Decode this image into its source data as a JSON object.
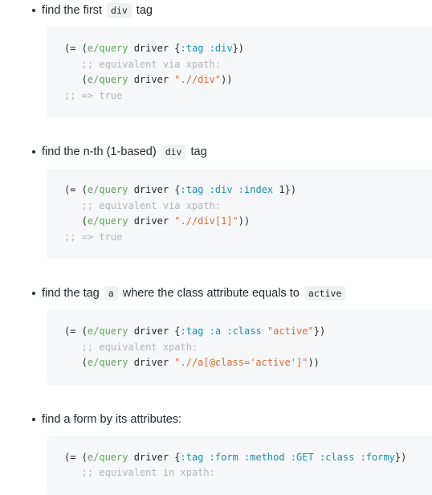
{
  "page": {
    "background": "#ffffff",
    "code_block_background": "#f5f7f8",
    "inline_code_background": "#f0f1f2",
    "colors": {
      "text": "#24292e",
      "function": "#63a35c",
      "keyword": "#1b8fb3",
      "string": "#dd6a33",
      "comment": "#b3b8bd",
      "punctuation": "#24292e"
    }
  },
  "items": [
    {
      "bullet": "•",
      "text_parts": [
        {
          "type": "text",
          "value": "find the first "
        },
        {
          "type": "code",
          "value": "div"
        },
        {
          "type": "text",
          "value": " tag"
        }
      ],
      "plain_text": "find the first div tag",
      "code": {
        "lines": [
          [
            {
              "c": "paren",
              "t": "(= ("
            },
            {
              "c": "fn",
              "t": "e/query"
            },
            {
              "c": "plain",
              "t": " driver "
            },
            {
              "c": "paren",
              "t": "{"
            },
            {
              "c": "kw",
              "t": ":tag"
            },
            {
              "c": "plain",
              "t": " "
            },
            {
              "c": "kw",
              "t": ":div"
            },
            {
              "c": "paren",
              "t": "})"
            }
          ],
          [
            {
              "c": "com",
              "t": "   ;; equivalent via xpath:"
            }
          ],
          [
            {
              "c": "paren",
              "t": "   ("
            },
            {
              "c": "fn",
              "t": "e/query"
            },
            {
              "c": "plain",
              "t": " driver "
            },
            {
              "c": "str",
              "t": "\".//div\""
            },
            {
              "c": "paren",
              "t": "))"
            }
          ],
          [
            {
              "c": "com",
              "t": ";; => true"
            }
          ]
        ],
        "plain_text": "(= (e/query driver {:tag :div})\n   ;; equivalent via xpath:\n   (e/query driver \".//div\"))\n;; => true"
      }
    },
    {
      "bullet": "•",
      "text_parts": [
        {
          "type": "text",
          "value": "find the n-th (1-based) "
        },
        {
          "type": "code",
          "value": "div"
        },
        {
          "type": "text",
          "value": " tag"
        }
      ],
      "plain_text": "find the n-th (1-based) div tag",
      "code": {
        "lines": [
          [
            {
              "c": "paren",
              "t": "(= ("
            },
            {
              "c": "fn",
              "t": "e/query"
            },
            {
              "c": "plain",
              "t": " driver "
            },
            {
              "c": "paren",
              "t": "{"
            },
            {
              "c": "kw",
              "t": ":tag"
            },
            {
              "c": "plain",
              "t": " "
            },
            {
              "c": "kw",
              "t": ":div"
            },
            {
              "c": "plain",
              "t": " "
            },
            {
              "c": "kw",
              "t": ":index"
            },
            {
              "c": "num",
              "t": " 1"
            },
            {
              "c": "paren",
              "t": "})"
            }
          ],
          [
            {
              "c": "com",
              "t": "   ;; equivalent via xpath:"
            }
          ],
          [
            {
              "c": "paren",
              "t": "   ("
            },
            {
              "c": "fn",
              "t": "e/query"
            },
            {
              "c": "plain",
              "t": " driver "
            },
            {
              "c": "str",
              "t": "\".//div[1]\""
            },
            {
              "c": "paren",
              "t": "))"
            }
          ],
          [
            {
              "c": "com",
              "t": ";; => true"
            }
          ]
        ],
        "plain_text": "(= (e/query driver {:tag :div :index 1})\n   ;; equivalent via xpath:\n   (e/query driver \".//div[1]\"))\n;; => true"
      }
    },
    {
      "bullet": "•",
      "text_parts": [
        {
          "type": "text",
          "value": "find the tag "
        },
        {
          "type": "code",
          "value": "a"
        },
        {
          "type": "text",
          "value": " where the class attribute equals to "
        },
        {
          "type": "code",
          "value": "active"
        }
      ],
      "plain_text": "find the tag a where the class attribute equals to active",
      "code": {
        "lines": [
          [
            {
              "c": "paren",
              "t": "(= ("
            },
            {
              "c": "fn",
              "t": "e/query"
            },
            {
              "c": "plain",
              "t": " driver "
            },
            {
              "c": "paren",
              "t": "{"
            },
            {
              "c": "kw",
              "t": ":tag"
            },
            {
              "c": "plain",
              "t": " "
            },
            {
              "c": "kw",
              "t": ":a"
            },
            {
              "c": "plain",
              "t": " "
            },
            {
              "c": "kw",
              "t": ":class"
            },
            {
              "c": "plain",
              "t": " "
            },
            {
              "c": "str",
              "t": "\"active\""
            },
            {
              "c": "paren",
              "t": "})"
            }
          ],
          [
            {
              "c": "com",
              "t": "   ;; equivalent xpath:"
            }
          ],
          [
            {
              "c": "paren",
              "t": "   ("
            },
            {
              "c": "fn",
              "t": "e/query"
            },
            {
              "c": "plain",
              "t": " driver "
            },
            {
              "c": "str",
              "t": "\".//a[@class='active']\""
            },
            {
              "c": "paren",
              "t": "))"
            }
          ]
        ],
        "plain_text": "(= (e/query driver {:tag :a :class \"active\"})\n   ;; equivalent xpath:\n   (e/query driver \".//a[@class='active']\"))"
      }
    },
    {
      "bullet": "•",
      "text_parts": [
        {
          "type": "text",
          "value": "find a form by its attributes:"
        }
      ],
      "plain_text": "find a form by its attributes:",
      "code": {
        "lines": [
          [
            {
              "c": "paren",
              "t": "(= ("
            },
            {
              "c": "fn",
              "t": "e/query"
            },
            {
              "c": "plain",
              "t": " driver "
            },
            {
              "c": "paren",
              "t": "{"
            },
            {
              "c": "kw",
              "t": ":tag"
            },
            {
              "c": "plain",
              "t": " "
            },
            {
              "c": "kw",
              "t": ":form"
            },
            {
              "c": "plain",
              "t": " "
            },
            {
              "c": "kw",
              "t": ":method"
            },
            {
              "c": "plain",
              "t": " "
            },
            {
              "c": "kw",
              "t": ":GET"
            },
            {
              "c": "plain",
              "t": " "
            },
            {
              "c": "kw",
              "t": ":class"
            },
            {
              "c": "plain",
              "t": " "
            },
            {
              "c": "kw",
              "t": ":formy"
            },
            {
              "c": "paren",
              "t": "})"
            }
          ],
          [
            {
              "c": "com",
              "t": "   ;; equivalent in xpath:"
            }
          ]
        ],
        "plain_text": "(= (e/query driver {:tag :form :method :GET :class :formy})\n   ;; equivalent in xpath:"
      }
    }
  ]
}
